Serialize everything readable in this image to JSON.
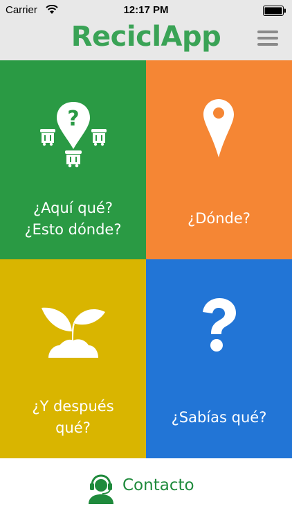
{
  "status_bar": {
    "carrier": "Carrier",
    "time": "12:17 PM"
  },
  "header": {
    "app_title": "ReciclApp"
  },
  "tiles": [
    {
      "label": "¿Aquí qué?\n¿Esto dónde?",
      "color": "#2a9a44",
      "icon": "bins-question-icon"
    },
    {
      "label": "¿Dónde?",
      "color": "#f58634",
      "icon": "location-pin-icon"
    },
    {
      "label": "¿Y después\nqué?",
      "color": "#d9b500",
      "icon": "sprout-icon"
    },
    {
      "label": "¿Sabías qué?",
      "color": "#2275d6",
      "icon": "question-mark-icon"
    }
  ],
  "footer": {
    "contact_label": "Contacto",
    "icon": "support-agent-icon"
  },
  "colors": {
    "brand_green": "#3aa356",
    "bar_bg": "#e8e8e8"
  }
}
